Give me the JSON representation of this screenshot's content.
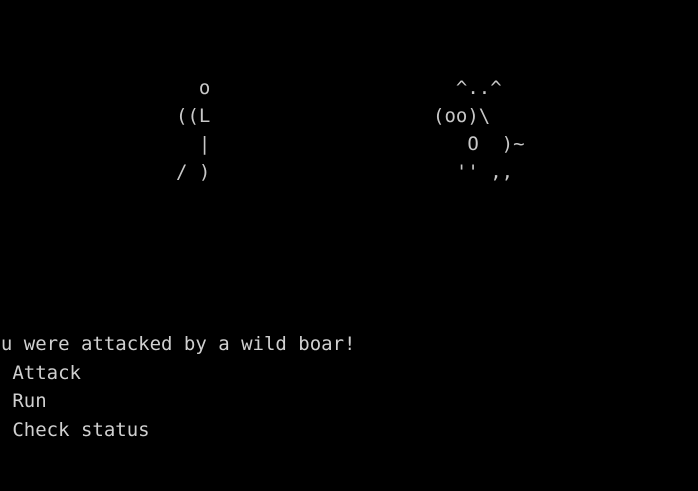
{
  "player_art": [
    "  o",
    "((L",
    "  |",
    "/ )"
  ],
  "boar_art": [
    "  ^..^",
    "(oo)\\",
    "   O  )~",
    "  '' ,,"
  ],
  "battle_message": "You were attacked by a wild boar!",
  "menu": [
    "1. Attack",
    "2. Run",
    "3. Check status"
  ]
}
